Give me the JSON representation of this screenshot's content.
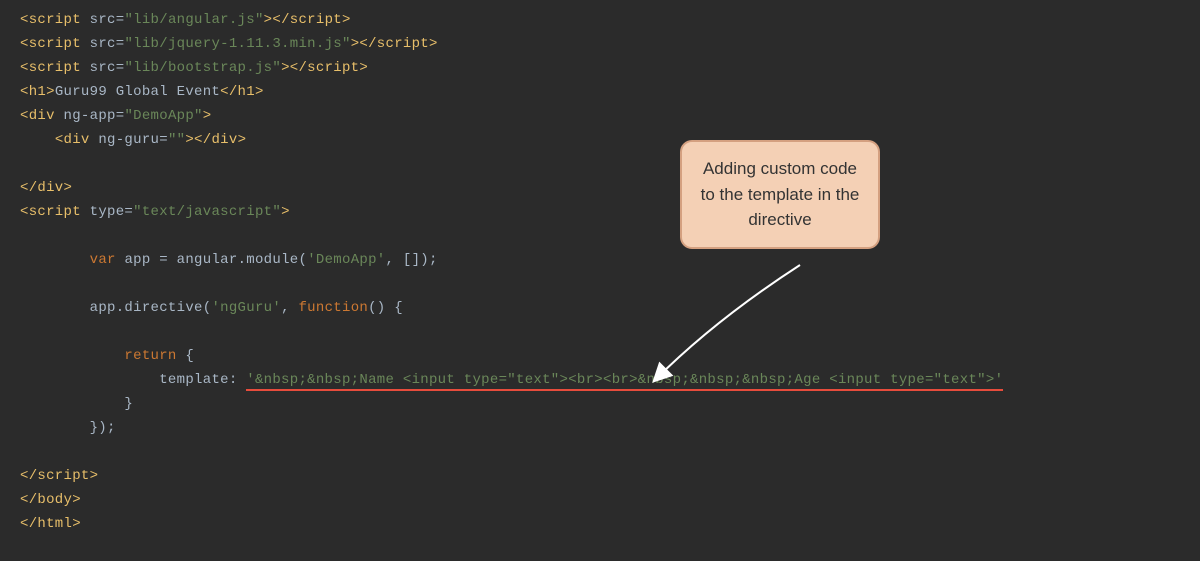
{
  "code": {
    "script1_src": "\"lib/angular.js\"",
    "script2_src": "\"lib/jquery-1.11.3.min.js\"",
    "script3_src": "\"lib/bootstrap.js\"",
    "h1_text": "Guru99 Global Event",
    "ngapp_attr": "ng-app",
    "ngapp_val": "\"DemoApp\"",
    "ngguru_attr": "ng-guru",
    "ngguru_val": "\"\"",
    "script_type": "\"text/javascript\"",
    "var_kw": "var",
    "app_var": "app",
    "angular_mod": "angular.module",
    "demoapp_str": "'DemoApp'",
    "app_directive": "app.directive",
    "ngguru_str": "'ngGuru'",
    "function_kw": "function",
    "return_kw": "return",
    "template_key": "template: ",
    "template_val": "'&nbsp;&nbsp;Name <input type=\"text\"><br><br>&nbsp;&nbsp;&nbsp;Age <input type=\"text\">'"
  },
  "callout": {
    "text": "Adding custom code to the template in the directive"
  }
}
